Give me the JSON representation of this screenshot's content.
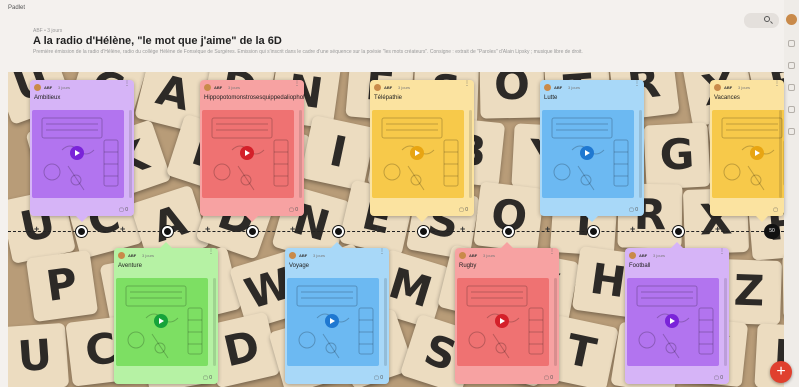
{
  "app": {
    "name": "Padlet"
  },
  "header": {
    "crumb": "ABF • 3 jours",
    "title": "A la radio d'Hélène, \"le mot que j'aime\" de la 6D",
    "description": "Première émission de la radio d'Hélène, radio du collège Hélène de Fonséque de Surgères. Emission qui s'inscrit dans le cadre d'une séquence sur la poésie \"les mots créateurs\". Consigne : extrait de \"Paroles\" d'Alain Lipsky ; musique libre de droit."
  },
  "icons": {
    "search": "search-icon",
    "menu": "more-vertical-icon",
    "play": "play-icon",
    "comment": "comment-icon",
    "add": "plus-icon"
  },
  "card_meta": {
    "author": "ABF",
    "time": "3 jours"
  },
  "cards": [
    {
      "title": "Ambitieux",
      "color": "#d6b4f7",
      "media": "#b274ef",
      "play": "#7a23d9",
      "comments": "0",
      "row": "top"
    },
    {
      "title": "Hippopotomonstrosesquippedaliophobie",
      "color": "#f7a2a2",
      "media": "#ef7272",
      "play": "#d4202a",
      "comments": "0",
      "row": "top"
    },
    {
      "title": "Télépathie",
      "color": "#fbe3a0",
      "media": "#f7c94a",
      "play": "#e8a512",
      "comments": "0",
      "row": "top"
    },
    {
      "title": "Lutte",
      "color": "#a8d8f8",
      "media": "#6cb9f2",
      "play": "#1f78d1",
      "comments": "0",
      "row": "top"
    },
    {
      "title": "Vacances",
      "color": "#fbe3a0",
      "media": "#f7c94a",
      "play": "#e8a512",
      "comments": "",
      "row": "top"
    },
    {
      "title": "Aventure",
      "color": "#b6f2a4",
      "media": "#7ddf63",
      "play": "#17a33a",
      "comments": "0",
      "row": "bottom"
    },
    {
      "title": "Voyage",
      "color": "#a8d8f8",
      "media": "#6cb9f2",
      "play": "#1f78d1",
      "comments": "0",
      "row": "bottom"
    },
    {
      "title": "Rugby",
      "color": "#f7a2a2",
      "media": "#ef7272",
      "play": "#d4202a",
      "comments": "0",
      "row": "bottom"
    },
    {
      "title": "Football",
      "color": "#d6b4f7",
      "media": "#b274ef",
      "play": "#7a23d9",
      "comments": "0",
      "row": "bottom"
    }
  ],
  "timeline": {
    "end_label": "50"
  },
  "fab_label": "+"
}
